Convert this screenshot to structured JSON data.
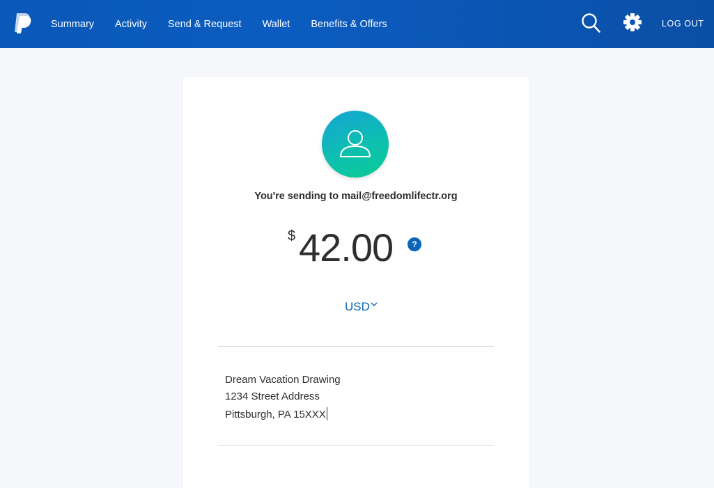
{
  "header": {
    "nav": [
      "Summary",
      "Activity",
      "Send & Request",
      "Wallet",
      "Benefits & Offers"
    ],
    "logout_label": "LOG OUT",
    "icons": {
      "logo": "paypal-logo-icon",
      "search": "search-icon",
      "settings": "gear-icon"
    },
    "colors": {
      "bar": "#0b5cc0",
      "text": "#ffffff"
    }
  },
  "payment": {
    "recipient_text": "You're sending to mail@freedomlifectr.org",
    "currency_symbol": "$",
    "amount": "42.00",
    "help_label": "?",
    "currency": "USD",
    "note_lines": [
      "Dream Vacation Drawing",
      "1234 Street Address",
      "Pittsburgh, PA 15XXX"
    ],
    "colors": {
      "link": "#0b66b8",
      "text": "#2c2e2f",
      "avatar": "#0dbfb0"
    }
  }
}
